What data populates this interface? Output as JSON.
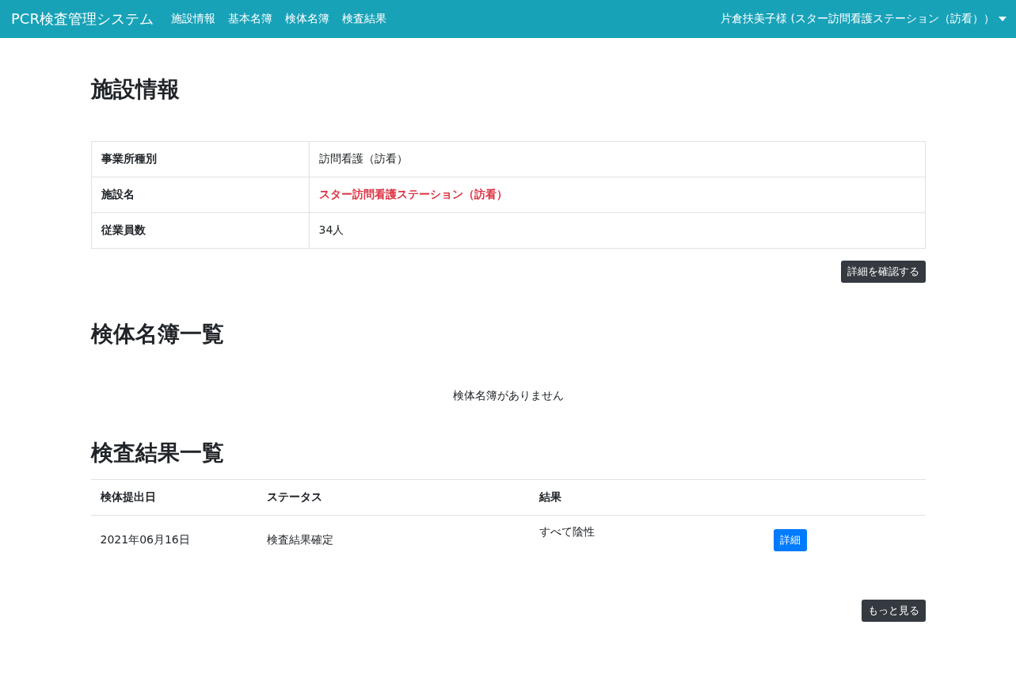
{
  "navbar": {
    "brand": "PCR検査管理システム",
    "links": [
      "施設情報",
      "基本名簿",
      "検体名簿",
      "検査結果"
    ],
    "user": "片倉扶美子様 (スター訪問看護ステーション（訪看））"
  },
  "facility": {
    "title": "施設情報",
    "rows": [
      {
        "label": "事業所種別",
        "value": "訪問看護（訪看）",
        "highlight": false
      },
      {
        "label": "施設名",
        "value": "スター訪問看護ステーション（訪看）",
        "highlight": true
      },
      {
        "label": "従業員数",
        "value": "34人",
        "highlight": false
      }
    ],
    "button": "詳細を確認する"
  },
  "specimens": {
    "title": "検体名簿一覧",
    "empty_message": "検体名簿がありません"
  },
  "results": {
    "title": "検査結果一覧",
    "columns": [
      "検体提出日",
      "ステータス",
      "結果"
    ],
    "rows": [
      {
        "date": "2021年06月16日",
        "status": "検査結果確定",
        "result": "すべて陰性",
        "button": "詳細"
      }
    ],
    "more_button": "もっと見る"
  }
}
